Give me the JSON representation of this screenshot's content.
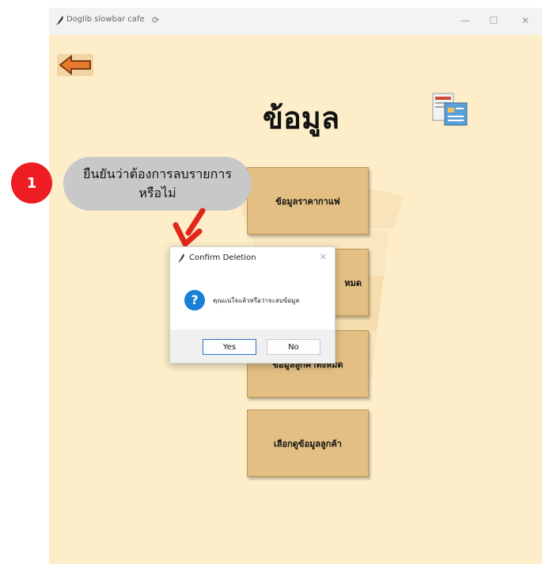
{
  "window": {
    "title": "Doglib slowbar cafe",
    "sync_icon": "sync-icon",
    "controls": {
      "minimize": "—",
      "maximize": "☐",
      "close": "✕"
    }
  },
  "page": {
    "heading": "ข้อมูล",
    "back_icon": "back-arrow-icon",
    "heading_icon": "document-icon"
  },
  "menu": {
    "coffee_price": "ข้อมูลราคากาแฟ",
    "all_data": "หมด",
    "all_customers": "ข้อมูลลูกค้าทั้งหมด",
    "choose_customer": "เลือกดูข้อมูลลูกค้า"
  },
  "callout": {
    "number": "1",
    "line1": "ยืนยันว่าต้องการลบรายการ",
    "line2": "หรือไม่"
  },
  "dialog": {
    "title": "Confirm Deletion",
    "close": "✕",
    "message": "คุณแน่ใจแล้วหรือว่าจะลบข้อมูล",
    "yes": "Yes",
    "no": "No"
  },
  "colors": {
    "window_bg": "#fdedc9",
    "button_bg": "#e3bf84",
    "callout_red": "#ee1d23",
    "arrow_red": "#e1261c",
    "dialog_accent": "#2b73c8"
  }
}
